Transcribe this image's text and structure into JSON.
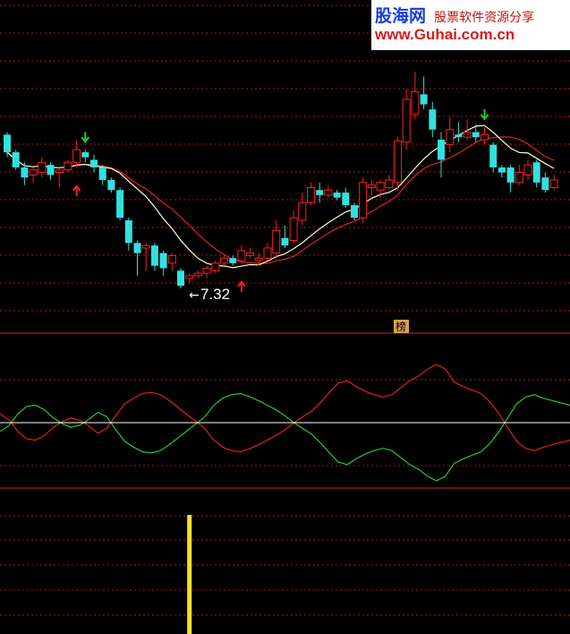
{
  "watermark": {
    "brand": "股海网",
    "slogan": "股票软件资源分享",
    "url": "www.Guhai.com.cn"
  },
  "colors": {
    "background": "#000000",
    "up_candle": "#ff2020",
    "down_candle": "#33e0e0",
    "ma_short": "#ffffcc",
    "ma_long": "#e02020",
    "osc_red": "#e02020",
    "osc_green": "#22cc22",
    "zero_line": "#ffffff",
    "grid": "#b01515",
    "divider": "#cc2222",
    "bar": "#ffe033",
    "signal_up": "#ff2020",
    "signal_down": "#22cc22"
  },
  "chart_data": [
    {
      "type": "candlestick",
      "panel": "price",
      "grid": true,
      "low_label": "7.32",
      "candles": [
        {
          "o": 1.0,
          "c": 0.86,
          "h": 1.02,
          "l": 0.82
        },
        {
          "o": 0.86,
          "c": 0.74,
          "h": 0.88,
          "l": 0.72
        },
        {
          "o": 0.74,
          "c": 0.66,
          "h": 0.78,
          "l": 0.6
        },
        {
          "o": 0.68,
          "c": 0.72,
          "h": 0.74,
          "l": 0.62
        },
        {
          "o": 0.7,
          "c": 0.78,
          "h": 0.82,
          "l": 0.66
        },
        {
          "o": 0.76,
          "c": 0.68,
          "h": 0.78,
          "l": 0.64
        },
        {
          "o": 0.7,
          "c": 0.72,
          "h": 0.74,
          "l": 0.58
        },
        {
          "o": 0.72,
          "c": 0.78,
          "h": 0.8,
          "l": 0.7
        },
        {
          "o": 0.78,
          "c": 0.88,
          "h": 0.95,
          "l": 0.74
        },
        {
          "o": 0.86,
          "c": 0.82,
          "h": 0.88,
          "l": 0.78
        },
        {
          "o": 0.8,
          "c": 0.74,
          "h": 0.84,
          "l": 0.7
        },
        {
          "o": 0.74,
          "c": 0.64,
          "h": 0.76,
          "l": 0.6
        },
        {
          "o": 0.64,
          "c": 0.56,
          "h": 0.66,
          "l": 0.54
        },
        {
          "o": 0.56,
          "c": 0.34,
          "h": 0.58,
          "l": 0.32
        },
        {
          "o": 0.32,
          "c": 0.14,
          "h": 0.34,
          "l": 0.08
        },
        {
          "o": 0.14,
          "c": 0.06,
          "h": 0.16,
          "l": -0.12
        },
        {
          "o": 0.1,
          "c": 0.12,
          "h": 0.14,
          "l": -0.08
        },
        {
          "o": 0.12,
          "c": -0.04,
          "h": 0.14,
          "l": -0.08
        },
        {
          "o": 0.06,
          "c": -0.06,
          "h": 0.08,
          "l": -0.12
        },
        {
          "o": -0.02,
          "c": 0.04,
          "h": 0.06,
          "l": -0.08
        },
        {
          "o": -0.08,
          "c": -0.2,
          "h": -0.06,
          "l": -0.22
        },
        {
          "o": -0.14,
          "c": -0.12,
          "h": -0.1,
          "l": -0.18
        },
        {
          "o": -0.12,
          "c": -0.1,
          "h": -0.08,
          "l": -0.14
        },
        {
          "o": -0.1,
          "c": -0.06,
          "h": -0.04,
          "l": -0.14
        },
        {
          "o": -0.08,
          "c": -0.02,
          "h": 0.0,
          "l": -0.1
        },
        {
          "o": -0.02,
          "c": 0.02,
          "h": 0.04,
          "l": -0.04
        },
        {
          "o": 0.02,
          "c": -0.02,
          "h": 0.04,
          "l": -0.04
        },
        {
          "o": 0.0,
          "c": 0.08,
          "h": 0.12,
          "l": -0.02
        },
        {
          "o": 0.04,
          "c": 0.06,
          "h": 0.1,
          "l": 0.02
        },
        {
          "o": 0.0,
          "c": 0.02,
          "h": 0.06,
          "l": -0.04
        },
        {
          "o": 0.02,
          "c": 0.1,
          "h": 0.14,
          "l": 0.0
        },
        {
          "o": 0.06,
          "c": 0.24,
          "h": 0.32,
          "l": 0.02
        },
        {
          "o": 0.18,
          "c": 0.12,
          "h": 0.28,
          "l": 0.1
        },
        {
          "o": 0.16,
          "c": 0.34,
          "h": 0.4,
          "l": 0.14
        },
        {
          "o": 0.32,
          "c": 0.46,
          "h": 0.54,
          "l": 0.28
        },
        {
          "o": 0.46,
          "c": 0.58,
          "h": 0.62,
          "l": 0.44
        },
        {
          "o": 0.56,
          "c": 0.52,
          "h": 0.62,
          "l": 0.46
        },
        {
          "o": 0.52,
          "c": 0.56,
          "h": 0.6,
          "l": 0.5
        },
        {
          "o": 0.54,
          "c": 0.5,
          "h": 0.56,
          "l": 0.48
        },
        {
          "o": 0.54,
          "c": 0.44,
          "h": 0.58,
          "l": 0.42
        },
        {
          "o": 0.44,
          "c": 0.34,
          "h": 0.46,
          "l": 0.32
        },
        {
          "o": 0.34,
          "c": 0.62,
          "h": 0.66,
          "l": 0.3
        },
        {
          "o": 0.58,
          "c": 0.6,
          "h": 0.64,
          "l": 0.52
        },
        {
          "o": 0.56,
          "c": 0.62,
          "h": 0.64,
          "l": 0.5
        },
        {
          "o": 0.58,
          "c": 0.64,
          "h": 0.68,
          "l": 0.56
        },
        {
          "o": 0.62,
          "c": 0.95,
          "h": 0.98,
          "l": 0.56
        },
        {
          "o": 0.94,
          "c": 1.28,
          "h": 1.36,
          "l": 0.88
        },
        {
          "o": 1.16,
          "c": 1.34,
          "h": 1.5,
          "l": 1.12
        },
        {
          "o": 1.32,
          "c": 1.24,
          "h": 1.46,
          "l": 1.2
        },
        {
          "o": 1.2,
          "c": 1.04,
          "h": 1.26,
          "l": 0.98
        },
        {
          "o": 0.96,
          "c": 0.8,
          "h": 1.02,
          "l": 0.66
        },
        {
          "o": 0.92,
          "c": 1.04,
          "h": 1.14,
          "l": 0.86
        },
        {
          "o": 1.0,
          "c": 0.98,
          "h": 1.1,
          "l": 0.94
        },
        {
          "o": 0.98,
          "c": 1.02,
          "h": 1.12,
          "l": 0.96
        },
        {
          "o": 1.02,
          "c": 0.98,
          "h": 1.08,
          "l": 0.94
        },
        {
          "o": 0.96,
          "c": 1.0,
          "h": 1.06,
          "l": 0.92
        },
        {
          "o": 0.92,
          "c": 0.74,
          "h": 0.94,
          "l": 0.7
        },
        {
          "o": 0.74,
          "c": 0.7,
          "h": 0.76,
          "l": 0.66
        },
        {
          "o": 0.74,
          "c": 0.62,
          "h": 0.76,
          "l": 0.54
        },
        {
          "o": 0.62,
          "c": 0.7,
          "h": 0.76,
          "l": 0.6
        },
        {
          "o": 0.68,
          "c": 0.76,
          "h": 0.8,
          "l": 0.64
        },
        {
          "o": 0.78,
          "c": 0.62,
          "h": 0.8,
          "l": 0.58
        },
        {
          "o": 0.66,
          "c": 0.56,
          "h": 0.7,
          "l": 0.54
        },
        {
          "o": 0.58,
          "c": 0.64,
          "h": 0.68,
          "l": 0.56
        }
      ],
      "signals": [
        {
          "index": 8,
          "direction": "up"
        },
        {
          "index": 9,
          "direction": "down"
        },
        {
          "index": 27,
          "direction": "up"
        },
        {
          "index": 55,
          "direction": "down"
        }
      ]
    },
    {
      "type": "line",
      "panel": "oscillator",
      "marker_text": "榜",
      "series": [
        {
          "color": "#e02020",
          "values": [
            0.15,
            0.05,
            -0.15,
            -0.28,
            -0.3,
            -0.22,
            -0.08,
            0.02,
            0.08,
            0.04,
            -0.06,
            -0.18,
            -0.1,
            0.12,
            0.32,
            0.42,
            0.5,
            0.52,
            0.48,
            0.38,
            0.26,
            0.14,
            0.02,
            -0.1,
            -0.3,
            -0.42,
            -0.48,
            -0.5,
            -0.45,
            -0.38,
            -0.3,
            -0.22,
            -0.12,
            0.0,
            0.1,
            0.2,
            0.35,
            0.52,
            0.68,
            0.72,
            0.62,
            0.54,
            0.48,
            0.44,
            0.48,
            0.6,
            0.72,
            0.8,
            0.92,
            1.0,
            0.92,
            0.7,
            0.62,
            0.56,
            0.5,
            0.36,
            0.16,
            -0.08,
            -0.32,
            -0.44,
            -0.48,
            -0.42,
            -0.38,
            -0.34,
            -0.3
          ]
        },
        {
          "color": "#22cc22",
          "values": [
            -0.15,
            -0.05,
            0.15,
            0.28,
            0.3,
            0.22,
            0.08,
            -0.02,
            -0.08,
            -0.04,
            0.06,
            0.18,
            0.1,
            -0.12,
            -0.32,
            -0.42,
            -0.5,
            -0.52,
            -0.48,
            -0.38,
            -0.26,
            -0.14,
            -0.02,
            0.1,
            0.3,
            0.42,
            0.48,
            0.5,
            0.45,
            0.38,
            0.3,
            0.22,
            0.12,
            0.0,
            -0.1,
            -0.2,
            -0.35,
            -0.52,
            -0.68,
            -0.72,
            -0.62,
            -0.54,
            -0.48,
            -0.44,
            -0.48,
            -0.6,
            -0.72,
            -0.8,
            -0.92,
            -1.0,
            -0.92,
            -0.7,
            -0.62,
            -0.56,
            -0.5,
            -0.36,
            -0.16,
            0.08,
            0.32,
            0.44,
            0.48,
            0.42,
            0.38,
            0.34,
            0.3
          ]
        }
      ]
    },
    {
      "type": "bar",
      "panel": "volume",
      "bars": [
        {
          "index": 21,
          "value": 1
        }
      ]
    }
  ]
}
